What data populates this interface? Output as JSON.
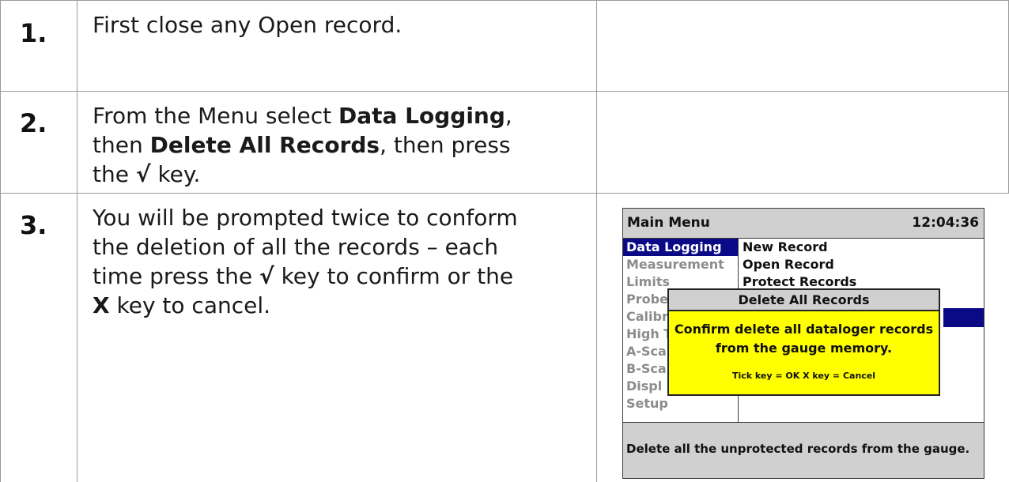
{
  "steps": [
    {
      "number": "1.",
      "text": "First close any Open record."
    },
    {
      "number": "2.",
      "line1_pre": "From the Menu select ",
      "line1_bold": "Data Logging",
      "line1_post": ",",
      "line2_pre": "then ",
      "line2_bold": "Delete All Records",
      "line2_post": ", then press",
      "line3_pre": "the ",
      "line3_bold": "√",
      "line3_post": " key."
    },
    {
      "number": "3.",
      "line1": "You will be prompted twice to conform",
      "line2": "the deletion of all the records – each",
      "line3_pre": "time press the ",
      "line3_bold": "√",
      "line3_post": " key to confirm or the",
      "line4_bold": "X",
      "line4_post": " key to cancel."
    }
  ],
  "gauge": {
    "title": "Main Menu",
    "time": "12:04:36",
    "left_menu": [
      "Data Logging",
      "Measurement",
      "Limits",
      "Probe",
      "Calibr",
      "High T",
      "A-Sca",
      "B-Sca",
      "Displ",
      "Setup"
    ],
    "right_menu": [
      "New Record",
      "Open Record",
      "Protect Records"
    ],
    "dialog": {
      "title": "Delete All Records",
      "message_line1": "Confirm delete all dataloger records",
      "message_line2": "from the gauge memory.",
      "keys": "Tick key = OK  X key = Cancel"
    },
    "status": "Delete all the unprotected records from the gauge.",
    "colors": {
      "selection": "#0a0a86",
      "dialog_bg": "#ffff00",
      "bar_bg": "#d0d0d0"
    }
  }
}
